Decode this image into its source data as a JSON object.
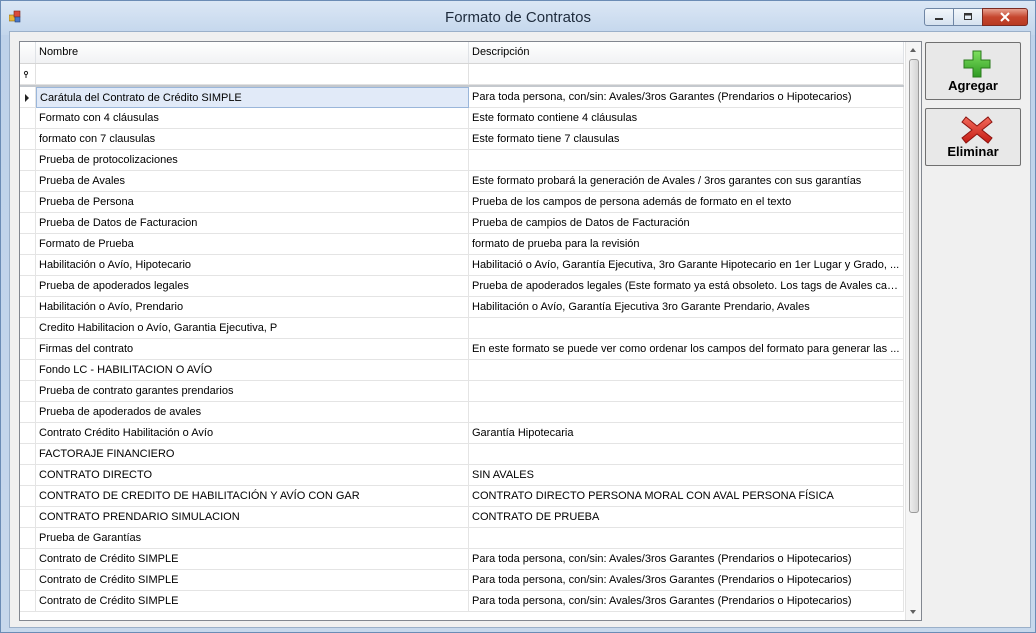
{
  "window": {
    "title": "Formato de Contratos"
  },
  "grid": {
    "columns": [
      "Nombre",
      "Descripción"
    ],
    "rows": [
      [
        "Carátula del Contrato de Crédito SIMPLE",
        "Para toda persona, con/sin: Avales/3ros Garantes (Prendarios o  Hipotecarios)"
      ],
      [
        "Formato con 4 cláusulas",
        "Este formato contiene 4 cláusulas"
      ],
      [
        "formato con 7 clausulas",
        "Este formato tiene 7 clausulas"
      ],
      [
        "Prueba de protocolizaciones",
        ""
      ],
      [
        "Prueba de Avales",
        "Este formato probará la generación de Avales / 3ros garantes con sus garantías"
      ],
      [
        "Prueba de Persona",
        "Prueba de los campos de persona además de formato en el texto"
      ],
      [
        "Prueba de Datos de Facturacion",
        "Prueba de campios de Datos de Facturación"
      ],
      [
        "Formato de Prueba",
        "formato de prueba para la revisión"
      ],
      [
        "Habilitación o Avío, Hipotecario",
        "Habilitació o Avío, Garantía Ejecutiva, 3ro Garante Hipotecario en 1er Lugar y Grado, ..."
      ],
      [
        "Prueba de apoderados legales",
        "Prueba de apoderados legales (Este formato ya está obsoleto. Los tags de Avales cam..."
      ],
      [
        "Habilitación o Avío, Prendario",
        "Habilitación o Avío, Garantía Ejecutiva 3ro Garante Prendario, Avales"
      ],
      [
        "Credito Habilitacion o Avío, Garantia Ejecutiva, P",
        ""
      ],
      [
        "Firmas del contrato",
        "En este formato se puede ver como ordenar los campos del formato para generar las ..."
      ],
      [
        "Fondo LC - HABILITACION O AVÍO",
        ""
      ],
      [
        "Prueba de contrato garantes prendarios",
        ""
      ],
      [
        "Prueba de apoderados de avales",
        ""
      ],
      [
        "Contrato Crédito Habilitación o Avío",
        "Garantía Hipotecaria"
      ],
      [
        "FACTORAJE FINANCIERO",
        ""
      ],
      [
        "CONTRATO DIRECTO",
        "SIN AVALES"
      ],
      [
        "CONTRATO DE CREDITO DE HABILITACIÓN Y AVÍO CON GAR",
        "CONTRATO DIRECTO PERSONA MORAL CON AVAL PERSONA FÍSICA"
      ],
      [
        "CONTRATO PRENDARIO SIMULACION",
        "CONTRATO DE PRUEBA"
      ],
      [
        "Prueba de Garantías",
        ""
      ],
      [
        "Contrato de Crédito SIMPLE",
        "Para toda persona, con/sin: Avales/3ros Garantes (Prendarios o  Hipotecarios)"
      ],
      [
        "Contrato de Crédito SIMPLE",
        "Para toda persona, con/sin: Avales/3ros Garantes (Prendarios o  Hipotecarios)"
      ],
      [
        "Contrato de Crédito SIMPLE",
        "Para toda persona, con/sin: Avales/3ros Garantes (Prendarios o  Hipotecarios)"
      ]
    ],
    "selected_row": 0
  },
  "actions": {
    "add_label": "Agregar",
    "delete_label": "Eliminar"
  },
  "icons": {
    "add": "plus-icon",
    "delete": "x-icon",
    "filter": "pin-icon"
  },
  "colors": {
    "add_icon": "#3cae2b",
    "delete_icon": "#d5271f",
    "selection": "#e1eaf8"
  }
}
